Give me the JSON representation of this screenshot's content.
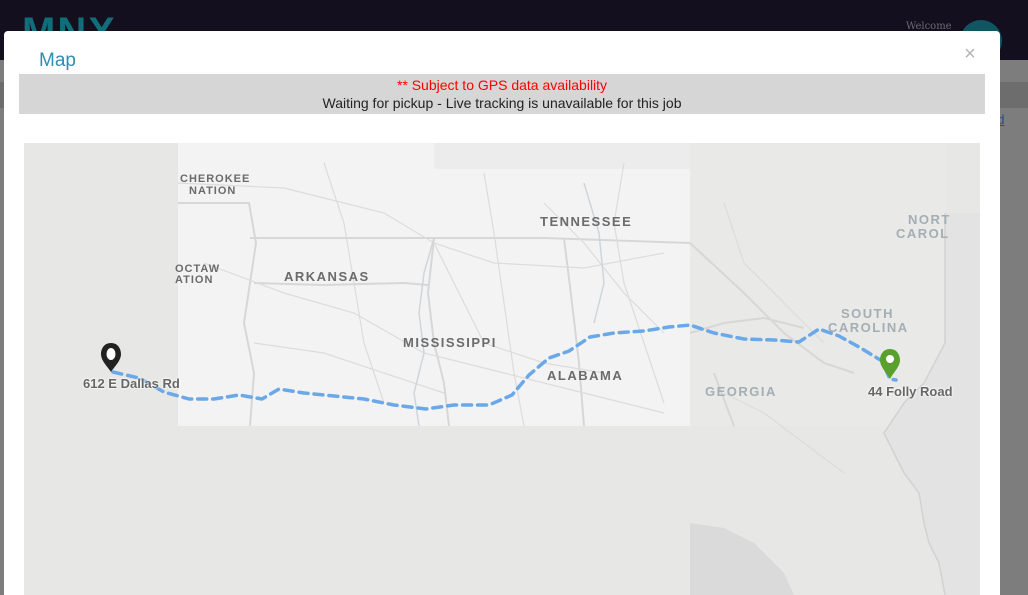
{
  "app": {
    "logo": "MNX",
    "welcome": "Welcome",
    "side_link": "ad"
  },
  "modal": {
    "title": "Map",
    "close_glyph": "×",
    "gps_warning": "** Subject to GPS data availability",
    "tracking_status": "Waiting for pickup - Live tracking is unavailable for this job"
  },
  "map": {
    "state_labels": {
      "tennessee": "TENNESSEE",
      "arkansas": "ARKANSAS",
      "mississippi": "MISSISSIPPI",
      "alabama": "ALABAMA",
      "georgia": "GEORGIA",
      "south_carolina_1": "SOUTH",
      "south_carolina_2": "CAROLINA",
      "north_carolina_1": "NORT",
      "north_carolina_2": "CAROL",
      "cherokee_1": "CHEROKEE",
      "cherokee_2": "NATION",
      "choctaw_1": "OCTAW",
      "choctaw_2": "ATION"
    },
    "origin": {
      "label": "612 E Dallas Rd",
      "marker_icon": "location-pin-icon",
      "marker_color": "#222222"
    },
    "destination": {
      "label": "44 Folly Road",
      "marker_icon": "location-pin-icon",
      "marker_color": "#5aa02c"
    },
    "route_color": "#6aa8e8"
  }
}
